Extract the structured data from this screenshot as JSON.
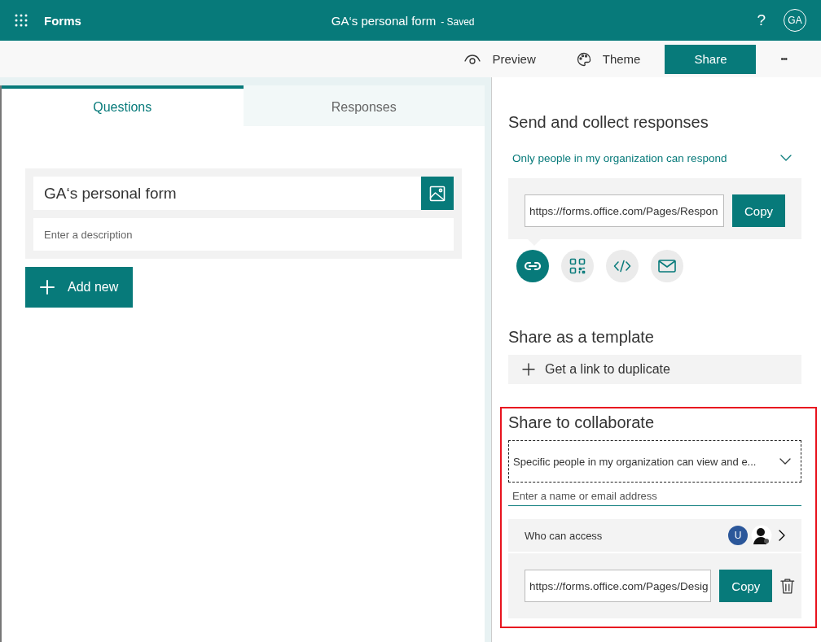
{
  "header": {
    "app_name": "Forms",
    "form_title": "GA‘s personal form",
    "save_state": "- Saved",
    "help": "?",
    "avatar": "GA"
  },
  "toolbar": {
    "buttons": [
      {
        "kind": "preview",
        "label": "Preview"
      },
      {
        "kind": "theme",
        "label": "Theme"
      },
      {
        "kind": "share",
        "label": "Share"
      },
      {
        "kind": "more",
        "label": "•••"
      }
    ]
  },
  "tabs": [
    {
      "label": "Questions",
      "selected": true
    },
    {
      "label": "Responses",
      "selected": false
    }
  ],
  "form": {
    "title": "GA‘s personal form",
    "description_placeholder": "Enter a description",
    "add_button": "Add new"
  },
  "send": {
    "heading": "Send and collect responses",
    "audience": "Only people in my organization can respond",
    "link": "https://forms.office.com/Pages/Respon",
    "copy": "Copy",
    "methods": [
      {
        "kind": "link",
        "selected": true
      },
      {
        "kind": "qr",
        "selected": false
      },
      {
        "kind": "embed",
        "selected": false
      },
      {
        "kind": "email",
        "selected": false
      }
    ]
  },
  "template": {
    "heading": "Share as a template",
    "button": "Get a link to duplicate"
  },
  "collaborate": {
    "highlighted": true,
    "heading": "Share to collaborate",
    "permission": "Specific people in my organization can view and e...",
    "people_placeholder": "Enter a name or email address",
    "access_label": "Who can access",
    "access_avatar": "U",
    "link": "https://forms.office.com/Pages/Desig",
    "copy": "Copy"
  }
}
